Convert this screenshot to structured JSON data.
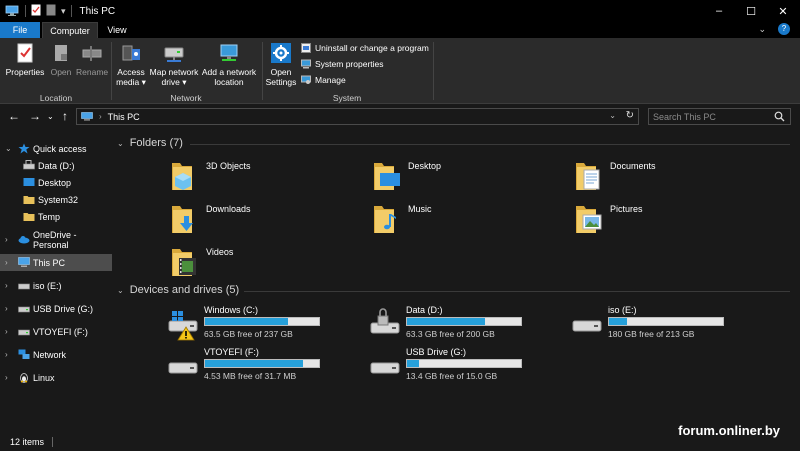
{
  "window": {
    "title": "This PC",
    "controls": {
      "minimize": "–",
      "maximize": "☐",
      "close": "✕"
    }
  },
  "ribbon": {
    "tabs": [
      "File",
      "Computer",
      "View"
    ],
    "active_tab": "Computer",
    "help_label": "?",
    "collapse_label": "⌄",
    "groups": {
      "location": {
        "label": "Location",
        "buttons": [
          "Properties",
          "Open",
          "Rename"
        ]
      },
      "network": {
        "label": "Network",
        "access_media": [
          "Access",
          "media ▾"
        ],
        "map_network_drive": [
          "Map network",
          "drive ▾"
        ],
        "add_network_location": [
          "Add a network",
          "location"
        ]
      },
      "system": {
        "label": "System",
        "open_settings": [
          "Open",
          "Settings"
        ],
        "small_buttons": [
          "Uninstall or change a program",
          "System properties",
          "Manage"
        ]
      }
    }
  },
  "navigation": {
    "back": "←",
    "forward": "→",
    "recent": "⌄",
    "up": "↑",
    "breadcrumb_separator": "›",
    "address": "This PC",
    "address_dropdown": "⌄",
    "refresh": "↻",
    "search_placeholder": "Search This PC"
  },
  "sidebar": {
    "items": [
      {
        "label": "Quick access",
        "expander": "⌄",
        "icon": "star-icon"
      },
      {
        "label": "Data (D:)",
        "icon": "drive-icon"
      },
      {
        "label": "Desktop",
        "icon": "desktop-icon"
      },
      {
        "label": "System32",
        "icon": "folder-icon"
      },
      {
        "label": "Temp",
        "icon": "folder-icon"
      },
      {
        "label": "OneDrive - Personal",
        "expander": "›",
        "icon": "cloud-icon"
      },
      {
        "label": "This PC",
        "expander": "›",
        "icon": "computer-icon",
        "selected": true
      },
      {
        "label": "iso (E:)",
        "expander": "›",
        "icon": "drive-icon"
      },
      {
        "label": "USB Drive (G:)",
        "expander": "›",
        "icon": "usb-drive-icon"
      },
      {
        "label": "VTOYEFI (F:)",
        "expander": "›",
        "icon": "usb-drive-icon"
      },
      {
        "label": "Network",
        "expander": "›",
        "icon": "network-icon"
      },
      {
        "label": "Linux",
        "expander": "›",
        "icon": "linux-icon"
      }
    ]
  },
  "main": {
    "folders_header": "Folders (7)",
    "folders_expander": "⌄",
    "folders": [
      {
        "name": "3D Objects",
        "icon": "3d-objects-folder-icon"
      },
      {
        "name": "Desktop",
        "icon": "desktop-folder-icon"
      },
      {
        "name": "Documents",
        "icon": "documents-folder-icon"
      },
      {
        "name": "Downloads",
        "icon": "downloads-folder-icon"
      },
      {
        "name": "Music",
        "icon": "music-folder-icon"
      },
      {
        "name": "Pictures",
        "icon": "pictures-folder-icon"
      },
      {
        "name": "Videos",
        "icon": "videos-folder-icon"
      }
    ],
    "drives_header": "Devices and drives (5)",
    "drives_expander": "⌄",
    "drives": [
      {
        "name": "Windows (C:)",
        "free_text": "63.5 GB free of 237 GB",
        "used_fraction": 0.732,
        "icon": "windows-drive-icon"
      },
      {
        "name": "Data (D:)",
        "free_text": "63.3 GB free of 200 GB",
        "used_fraction": 0.684,
        "icon": "locked-drive-icon"
      },
      {
        "name": "iso (E:)",
        "free_text": "180 GB free of 213 GB",
        "used_fraction": 0.155,
        "icon": "drive-icon"
      },
      {
        "name": "VTOYEFI (F:)",
        "free_text": "4.53 MB free of 31.7 MB",
        "used_fraction": 0.857,
        "icon": "drive-icon"
      },
      {
        "name": "USB Drive (G:)",
        "free_text": "13.4 GB free of 15.0 GB",
        "used_fraction": 0.107,
        "icon": "drive-icon"
      }
    ]
  },
  "status": {
    "item_count": "12 items"
  },
  "watermark": "forum.onliner.by",
  "colors": {
    "accent": "#1979ca",
    "progress": "#26a0da",
    "folder": "#e8c15a",
    "background": "#191919",
    "ribbon": "#2b2b2b"
  }
}
